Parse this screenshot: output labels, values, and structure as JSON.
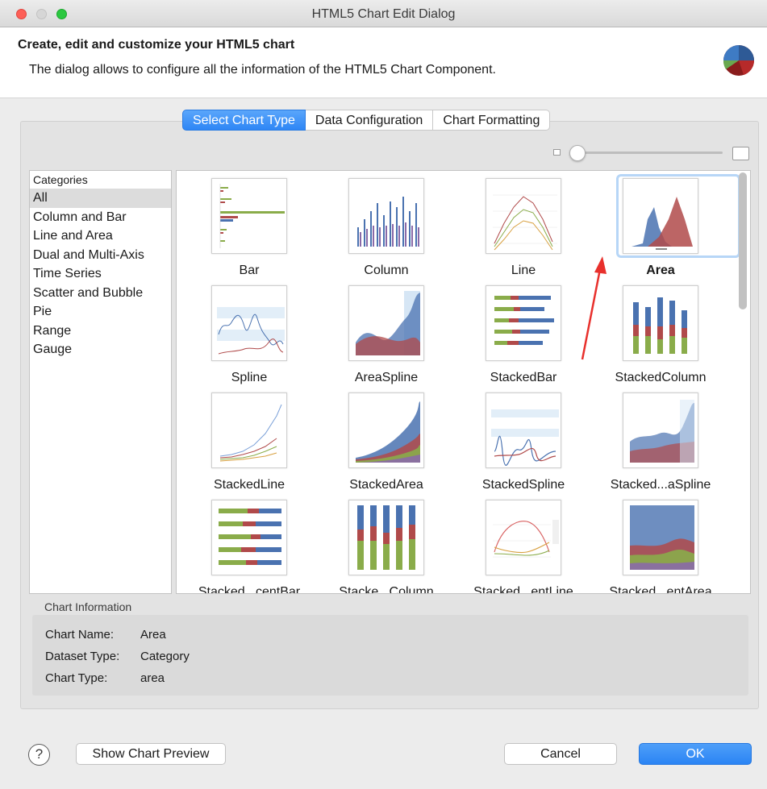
{
  "window": {
    "title": "HTML5 Chart Edit Dialog"
  },
  "header": {
    "title": "Create, edit and customize your HTML5 chart",
    "description": "The dialog allows to configure all the information of the HTML5 Chart Component."
  },
  "tabs": [
    {
      "label": "Select Chart Type",
      "active": true
    },
    {
      "label": "Data Configuration",
      "active": false
    },
    {
      "label": "Chart Formatting",
      "active": false
    }
  ],
  "zoom": {
    "level": 0.05
  },
  "categories": {
    "heading": "Categories",
    "items": [
      "All",
      "Column and Bar",
      "Line and Area",
      "Dual and Multi-Axis",
      "Time Series",
      "Scatter and Bubble",
      "Pie",
      "Range",
      "Gauge"
    ],
    "selected": "All"
  },
  "charts": [
    {
      "label": "Bar",
      "icon": "bar-chart-thumbnail"
    },
    {
      "label": "Column",
      "icon": "column-chart-thumbnail"
    },
    {
      "label": "Line",
      "icon": "line-chart-thumbnail"
    },
    {
      "label": "Area",
      "icon": "area-chart-thumbnail",
      "selected": true
    },
    {
      "label": "Spline",
      "icon": "spline-chart-thumbnail"
    },
    {
      "label": "AreaSpline",
      "icon": "areaspline-chart-thumbnail"
    },
    {
      "label": "StackedBar",
      "icon": "stackedbar-chart-thumbnail"
    },
    {
      "label": "StackedColumn",
      "icon": "stackedcolumn-chart-thumbnail"
    },
    {
      "label": "StackedLine",
      "icon": "stackedline-chart-thumbnail"
    },
    {
      "label": "StackedArea",
      "icon": "stackedarea-chart-thumbnail"
    },
    {
      "label": "StackedSpline",
      "icon": "stackedspline-chart-thumbnail"
    },
    {
      "label": "Stacked...aSpline",
      "icon": "stackedareaspline-chart-thumbnail"
    },
    {
      "label": "Stacked...centBar",
      "icon": "percentbar-chart-thumbnail"
    },
    {
      "label": "Stacke...Column",
      "icon": "percentcolumn-chart-thumbnail"
    },
    {
      "label": "Stacked...entLine",
      "icon": "percentline-chart-thumbnail"
    },
    {
      "label": "Stacked...entArea",
      "icon": "percentarea-chart-thumbnail"
    }
  ],
  "chart_information": {
    "title": "Chart Information",
    "rows": [
      {
        "key": "Chart Name:",
        "value": "Area"
      },
      {
        "key": "Dataset Type:",
        "value": "Category"
      },
      {
        "key": "Chart Type:",
        "value": "area"
      }
    ]
  },
  "footer": {
    "help": "?",
    "preview_label": "Show Chart Preview",
    "cancel_label": "Cancel",
    "ok_label": "OK"
  },
  "colors": {
    "accent": "#2e86f5",
    "series_blue": "#4a72b0",
    "series_red": "#b04a4a",
    "series_green": "#8aac4a",
    "series_purple": "#8a6aa8"
  }
}
